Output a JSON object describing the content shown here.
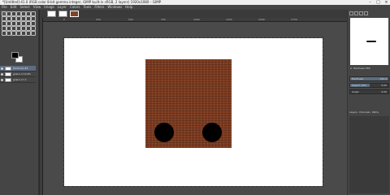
{
  "window": {
    "title": "*[Untitled]-41.0 (RGB color 8-bit gamma integer, GIMP built-in sRGB, 2 layers) 1920x1080 – GIMP",
    "minimize": "–",
    "maximize": "□",
    "close": "×"
  },
  "menu": [
    "File",
    "Edit",
    "Select",
    "View",
    "Image",
    "Layer",
    "Colors",
    "Tools",
    "Filters",
    "Windows",
    "Help"
  ],
  "toolbox": {
    "tool_icons": [
      "move-tool-icon",
      "rect-select-icon",
      "ellipse-select-icon",
      "free-select-icon",
      "fuzzy-select-icon",
      "color-select-icon",
      "scissors-icon",
      "foreground-select-icon",
      "paths-icon",
      "color-picker-icon",
      "zoom-icon",
      "measure-icon",
      "crop-icon",
      "rotate-icon",
      "scale-icon",
      "shear-icon",
      "perspective-icon",
      "flip-icon",
      "cage-icon",
      "warp-icon",
      "text-icon",
      "bucket-fill-icon",
      "gradient-icon",
      "pencil-icon",
      "paintbrush-icon",
      "eraser-icon",
      "airbrush-icon",
      "ink-icon",
      "mypaint-brush-icon",
      "clone-icon",
      "heal-icon",
      "perspective-clone-icon",
      "blur-icon",
      "smudge-icon",
      "dodge-burn-icon"
    ],
    "foreground_color": "#000000",
    "background_color": "#ffffff",
    "layers": [
      {
        "name": "[texture] #1",
        "selected": true
      },
      {
        "name": "gnsL1.crl.0 #1",
        "selected": false
      },
      {
        "name": "gnsL1.crl 1",
        "selected": false
      }
    ]
  },
  "image_tabs": [
    {
      "name": "image-tab-1",
      "active": false
    },
    {
      "name": "image-tab-2",
      "active": false
    },
    {
      "name": "image-tab-3",
      "active": true
    }
  ],
  "ruler": {
    "marks": [
      "0",
      "250",
      "500",
      "750",
      "1000",
      "1250",
      "1500",
      "1750"
    ]
  },
  "canvas": {
    "page_color": "#ffffff",
    "texture_color": "#7b3b20",
    "hole_color": "#000000"
  },
  "right_panel": {
    "brush_name": "2. Hardness 050",
    "properties": [
      {
        "label": "Hardness",
        "value": "100.0",
        "fill": 1.0
      },
      {
        "label": "Aspect ratio",
        "value": "0.00",
        "fill": 0.5
      },
      {
        "label": "Angle",
        "value": "0.00",
        "fill": 0.0
      }
    ],
    "tabs": [
      "Layers",
      "Channels",
      "Paths"
    ]
  }
}
